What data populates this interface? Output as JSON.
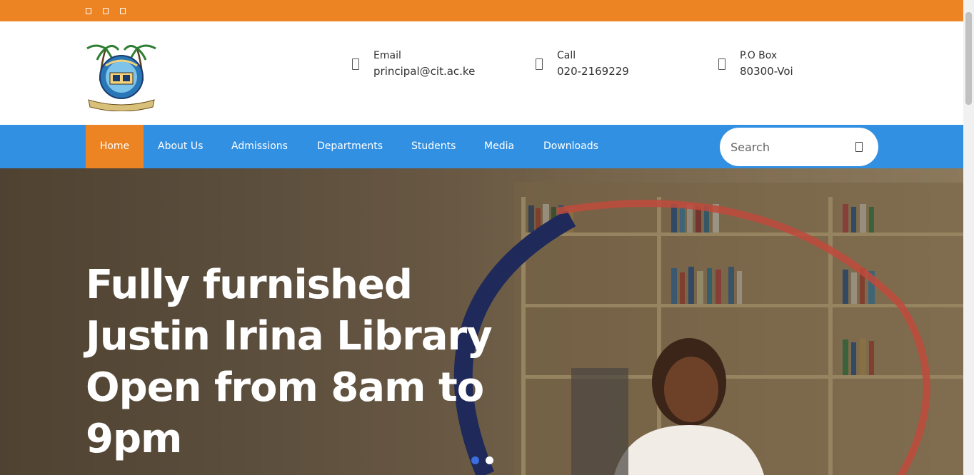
{
  "topbar": {
    "social_icons": [
      "facebook-icon",
      "twitter-icon",
      "instagram-icon"
    ],
    "color": "#ec8424"
  },
  "contacts": [
    {
      "label": "Email",
      "value": "principal@cit.ac.ke",
      "icon": "envelope-icon"
    },
    {
      "label": "Call",
      "value": "020-2169229",
      "icon": "phone-icon"
    },
    {
      "label": "P.O Box",
      "value": "80300-Voi",
      "icon": "location-icon"
    }
  ],
  "nav": {
    "items": [
      {
        "label": "Home",
        "active": true
      },
      {
        "label": "About Us",
        "active": false
      },
      {
        "label": "Admissions",
        "active": false
      },
      {
        "label": "Departments",
        "active": false
      },
      {
        "label": "Students",
        "active": false
      },
      {
        "label": "Media",
        "active": false
      },
      {
        "label": "Downloads",
        "active": false
      }
    ],
    "color": "#3290e3",
    "active_color": "#ec8424"
  },
  "search": {
    "placeholder": "Search",
    "icon": "search-icon"
  },
  "hero": {
    "title": "Fully furnished Justin Irina Library Open from 8am to 9pm",
    "slide_count": 2,
    "active_slide": 1,
    "dot_active_color": "#3b6fe0",
    "dot_color": "#ffffff"
  }
}
